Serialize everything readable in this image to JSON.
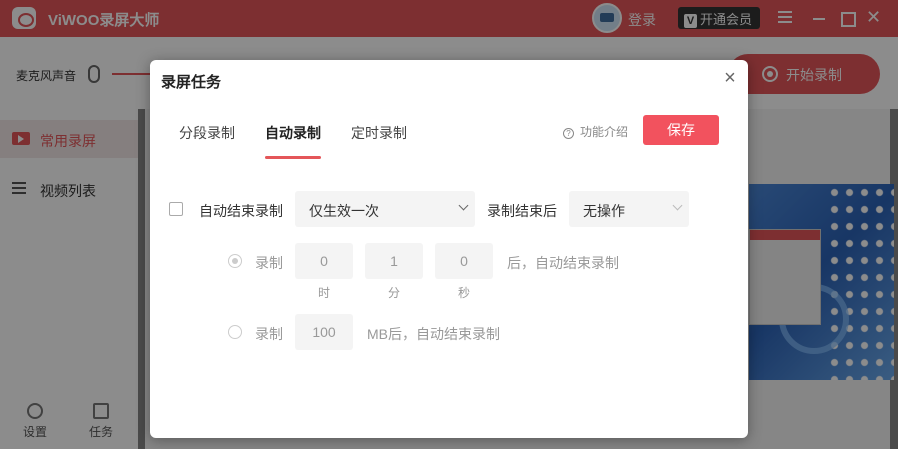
{
  "app": {
    "title": "ViWOO录屏大师",
    "login_label": "登录",
    "vip_label": "开通会员",
    "vip_badge_letter": "V"
  },
  "toolbar": {
    "mic_label": "麦克风声音",
    "start_label": "开始录制"
  },
  "sidebar": {
    "items": [
      {
        "label": "常用录屏",
        "active": true
      },
      {
        "label": "视频列表",
        "active": false
      }
    ],
    "bottom": [
      {
        "label": "设置"
      },
      {
        "label": "任务"
      }
    ]
  },
  "dialog": {
    "title": "录屏任务",
    "tabs": [
      {
        "label": "分段录制",
        "active": false
      },
      {
        "label": "自动录制",
        "active": true
      },
      {
        "label": "定时录制",
        "active": false
      }
    ],
    "help_label": "功能介绍",
    "help_icon_glyph": "?",
    "save_label": "保存",
    "auto_end": {
      "checkbox_label": "自动结束录制",
      "checked": false,
      "frequency_value": "仅生效一次",
      "after_end_label": "录制结束后",
      "after_end_value": "无操作"
    },
    "by_time": {
      "selected": true,
      "label": "录制",
      "hours": "0",
      "minutes": "1",
      "seconds": "0",
      "suffix": "后，自动结束录制",
      "units": [
        "时",
        "分",
        "秒"
      ]
    },
    "by_size": {
      "selected": false,
      "label": "录制",
      "size_mb": "100",
      "suffix": "MB后，自动结束录制"
    }
  },
  "colors": {
    "accent": "#e45659",
    "save_button": "#f2525e"
  }
}
